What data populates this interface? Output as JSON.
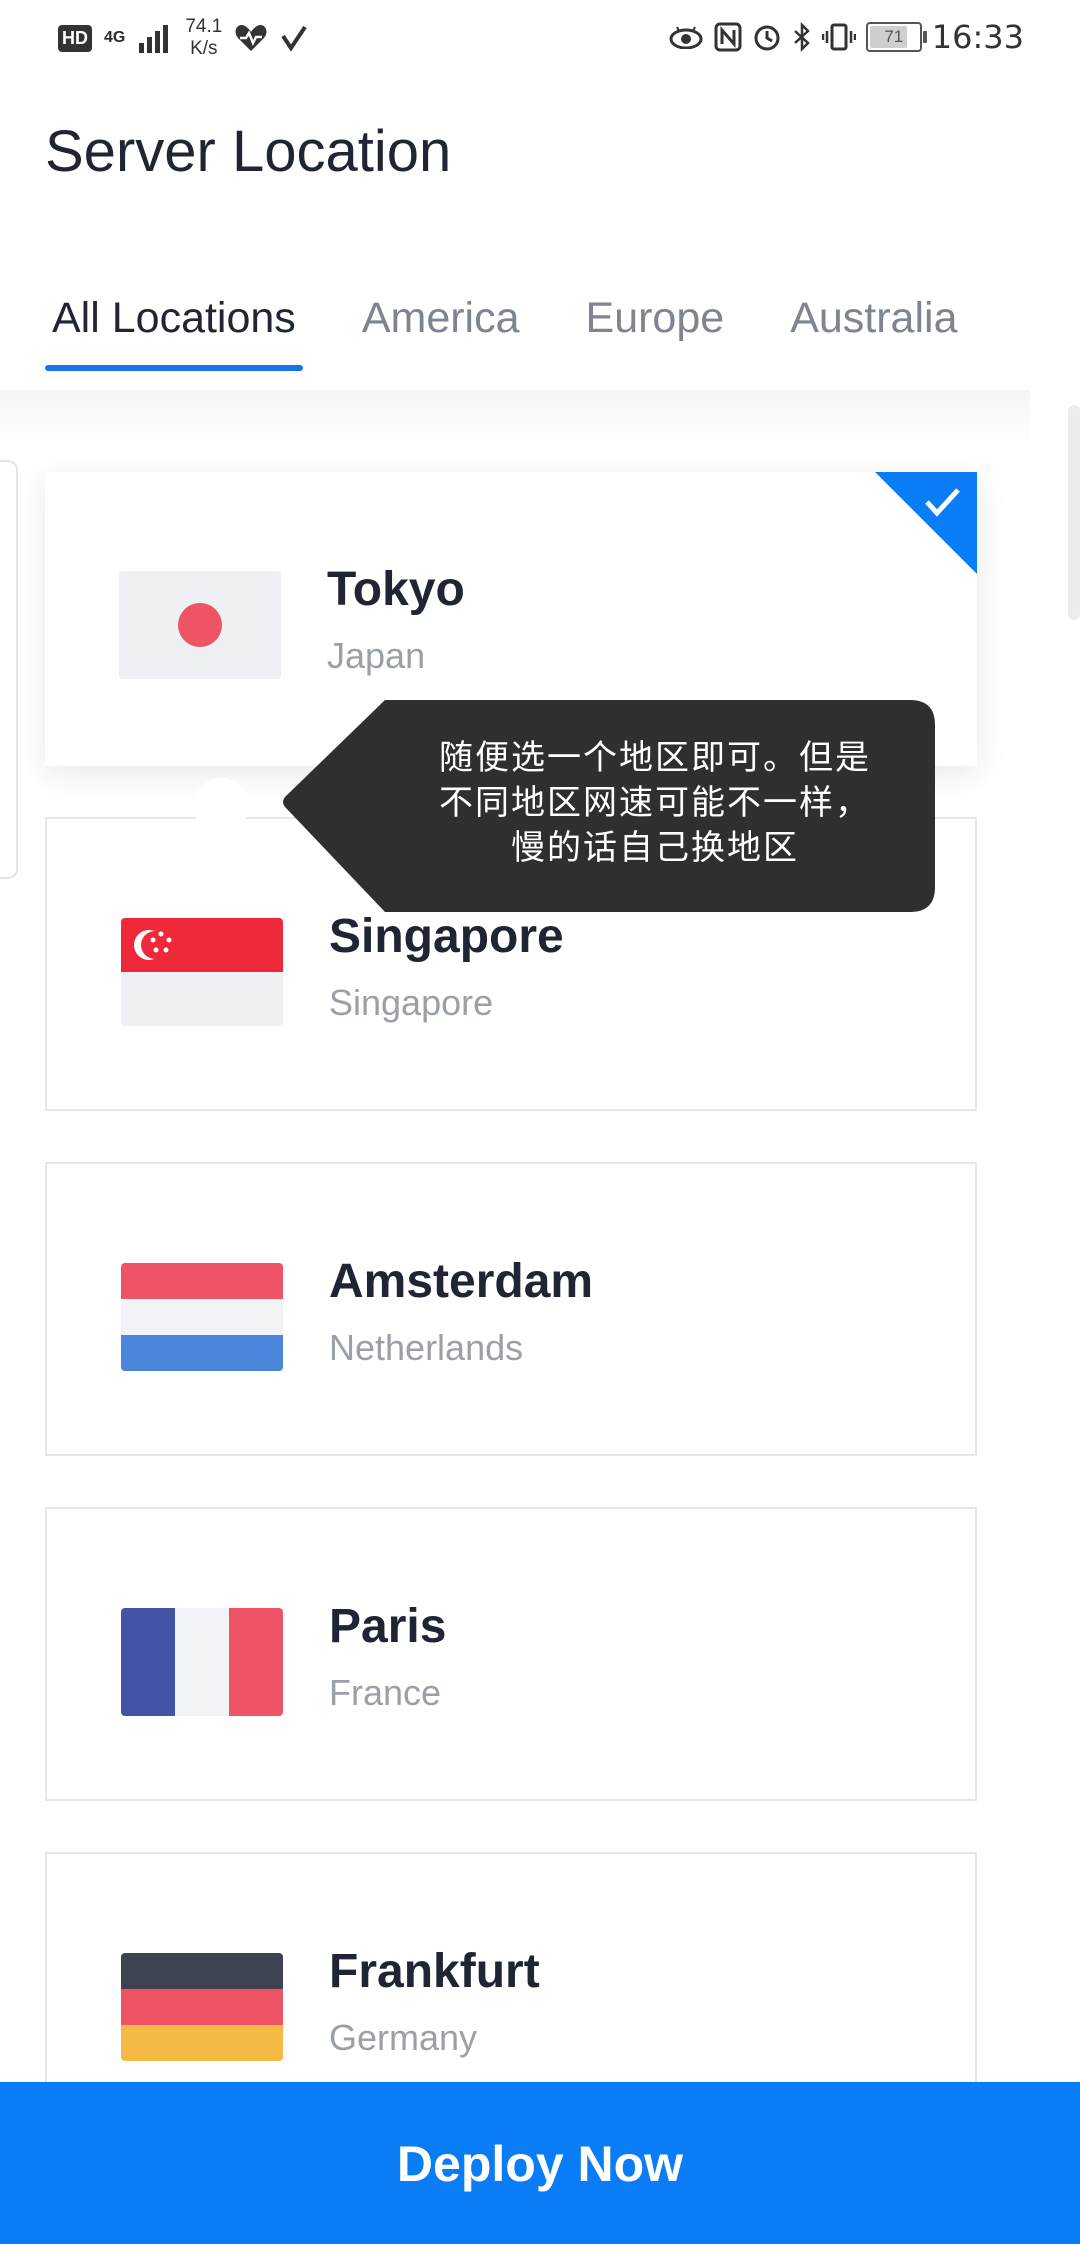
{
  "status_bar": {
    "hd": "HD",
    "network": "4G",
    "speed_value": "74.1",
    "speed_unit": "K/s",
    "battery": "71",
    "time": "16:33"
  },
  "page": {
    "title": "Server Location"
  },
  "tabs": [
    {
      "label": "All Locations",
      "active": true
    },
    {
      "label": "America",
      "active": false
    },
    {
      "label": "Europe",
      "active": false
    },
    {
      "label": "Australia",
      "active": false
    }
  ],
  "locations": [
    {
      "city": "Tokyo",
      "country": "Japan",
      "flag": "japan-flag",
      "selected": true
    },
    {
      "city": "Singapore",
      "country": "Singapore",
      "flag": "singapore-flag",
      "selected": false
    },
    {
      "city": "Amsterdam",
      "country": "Netherlands",
      "flag": "netherlands-flag",
      "selected": false
    },
    {
      "city": "Paris",
      "country": "France",
      "flag": "france-flag",
      "selected": false
    },
    {
      "city": "Frankfurt",
      "country": "Germany",
      "flag": "germany-flag",
      "selected": false
    }
  ],
  "tooltip": {
    "line1": "随便选一个地区即可。但是",
    "line2": "不同地区网速可能不一样，",
    "line3": "慢的话自己换地区"
  },
  "deploy_button": {
    "label": "Deploy Now"
  },
  "colors": {
    "accent": "#0a7cf5",
    "tab_indicator": "#1a73e8",
    "tooltip_bg": "#2f2f2f",
    "text_primary": "#1f2533",
    "text_secondary": "#9aa0a8"
  }
}
